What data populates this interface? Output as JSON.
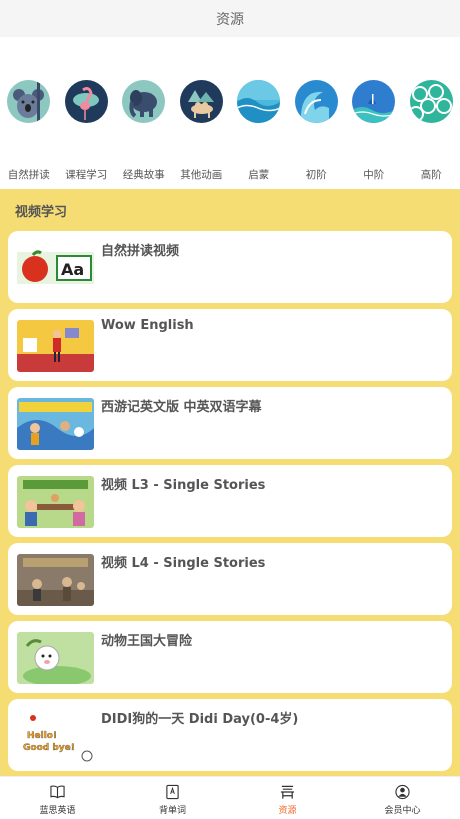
{
  "header": {
    "title": "资源"
  },
  "categories": [
    {
      "label": "自然拼读",
      "icon": "koala-icon",
      "bg": "#8cc7c0"
    },
    {
      "label": "课程学习",
      "icon": "flamingo-icon",
      "bg": "#203a5c"
    },
    {
      "label": "经典故事",
      "icon": "elephant-icon",
      "bg": "#8cc7c0"
    },
    {
      "label": "其他动画",
      "icon": "camel-icon",
      "bg": "#203a5c"
    },
    {
      "label": "启蒙",
      "icon": "wave-icon",
      "bg": "#4bb8dc"
    },
    {
      "label": "初阶",
      "icon": "wave-icon",
      "bg": "#2a8ad0"
    },
    {
      "label": "中阶",
      "icon": "island-wave-icon",
      "bg": "#2e7dcf"
    },
    {
      "label": "高阶",
      "icon": "waves-pattern-icon",
      "bg": "#2fb59b"
    }
  ],
  "section": {
    "title": "视频学习"
  },
  "videos": [
    {
      "title": "自然拼读视频",
      "thumb": "phonics-thumb"
    },
    {
      "title": "Wow English",
      "thumb": "wow-english-thumb"
    },
    {
      "title": "西游记英文版 中英双语字幕",
      "thumb": "journey-west-thumb"
    },
    {
      "title": "视频 L3 - Single Stories",
      "thumb": "l3-stories-thumb"
    },
    {
      "title": "视频 L4 - Single Stories",
      "thumb": "l4-stories-thumb"
    },
    {
      "title": "动物王国大冒险",
      "thumb": "animal-kingdom-thumb"
    },
    {
      "title": "DIDI狗的一天 Didi Day(0-4岁)",
      "thumb": "didi-day-thumb"
    }
  ],
  "tabbar": [
    {
      "label": "蓝思英语",
      "icon": "book-icon"
    },
    {
      "label": "背单词",
      "icon": "vocab-book-icon"
    },
    {
      "label": "资源",
      "icon": "resource-icon",
      "active": true
    },
    {
      "label": "会员中心",
      "icon": "user-icon"
    }
  ],
  "colors": {
    "accent": "#f06a2a",
    "section_bg": "#f5dc73"
  }
}
